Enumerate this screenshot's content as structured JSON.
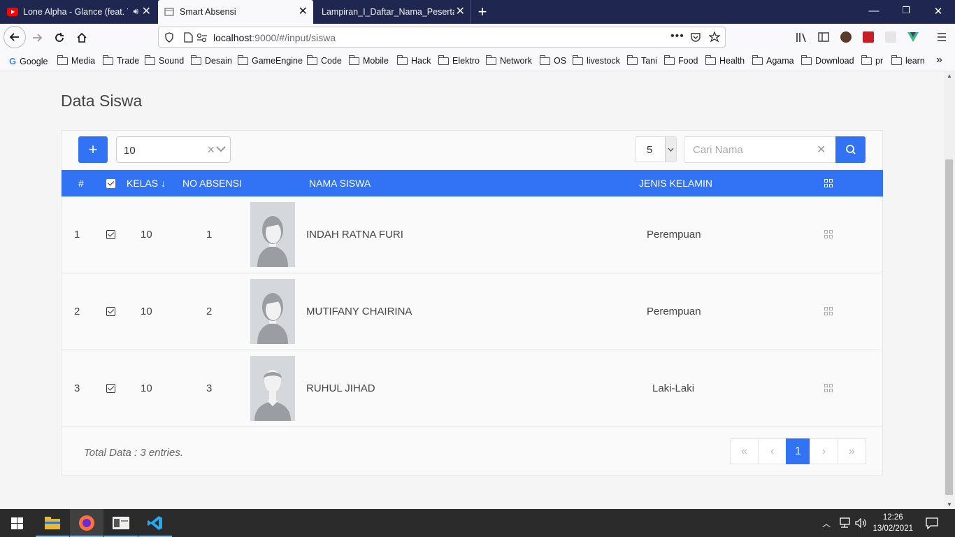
{
  "browser": {
    "tabs": [
      {
        "title": "Lone Alpha - Glance (feat. Y",
        "favicon": "youtube-icon",
        "active": false
      },
      {
        "title": "Smart Absensi",
        "favicon": "page-icon",
        "active": true
      },
      {
        "title": "Lampiran_I_Daftar_Nama_Peserta_d",
        "favicon": "",
        "active": false
      }
    ],
    "url_host": "localhost",
    "url_path": ":9000/#/input/siswa",
    "bookmarks": [
      "Google",
      "Media",
      "Trade",
      "Sound",
      "Desain",
      "GameEngine",
      "Code",
      "Mobile",
      "Hack",
      "Elektro",
      "Network",
      "OS",
      "livestock",
      "Tani",
      "Food",
      "Health",
      "Agama",
      "Download",
      "pr",
      "learn"
    ],
    "accent_tabbar": "#1f2750"
  },
  "page": {
    "title": "Data Siswa",
    "add_label": "+",
    "kelas_filter": "10",
    "per_page": "5",
    "search_placeholder": "Cari Nama",
    "accent": "#3273f6",
    "columns": {
      "num": "#",
      "kelas": "KELAS",
      "no_absensi": "NO ABSENSI",
      "nama": "NAMA SISWA",
      "jenis_kelamin": "JENIS KELAMIN"
    },
    "rows": [
      {
        "num": "1",
        "kelas": "10",
        "no_absensi": "1",
        "nama": "INDAH RATNA FURI",
        "jenis_kelamin": "Perempuan",
        "avatar": "female-avatar-icon"
      },
      {
        "num": "2",
        "kelas": "10",
        "no_absensi": "2",
        "nama": "MUTIFANY CHAIRINA",
        "jenis_kelamin": "Perempuan",
        "avatar": "female-avatar-icon"
      },
      {
        "num": "3",
        "kelas": "10",
        "no_absensi": "3",
        "nama": "RUHUL JIHAD",
        "jenis_kelamin": "Laki-Laki",
        "avatar": "male-avatar-icon"
      }
    ],
    "total_text": "Total Data : 3 entries.",
    "pagination": {
      "first": "«",
      "prev": "‹",
      "current": "1",
      "next": "›",
      "last": "»"
    }
  },
  "taskbar": {
    "time": "12:26",
    "date": "13/02/2021"
  }
}
